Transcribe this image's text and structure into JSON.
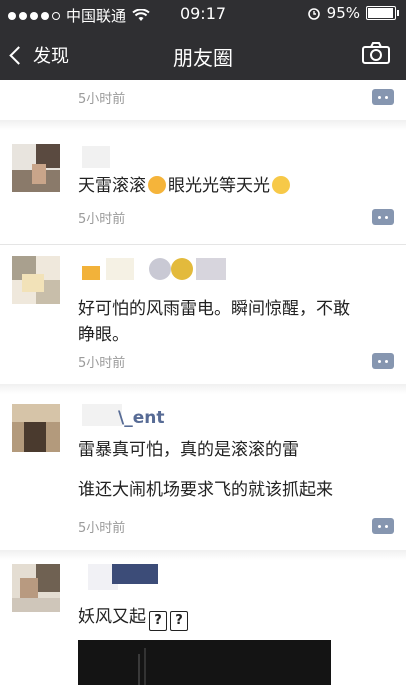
{
  "status_bar": {
    "carrier": "中国联通",
    "time": "09:17",
    "battery": "95%",
    "battery_level": 0.95
  },
  "nav": {
    "back_label": "发现",
    "title": "朋友圈"
  },
  "posts": [
    {
      "time": "5小时前"
    },
    {
      "text": "天雷滚滚😱眼光光等天光😁",
      "text_parts": [
        "天雷滚滚",
        "眼光光等天光"
      ],
      "time": "5小时前"
    },
    {
      "text_lines": [
        "好可怕的风雨雷电。瞬间惊醒，不敢",
        "睁眼。"
      ],
      "time": "5小时前"
    },
    {
      "name": "\\_ent",
      "text_lines": [
        "雷暴真可怕，真的是滚滚的雷",
        "谁还大闹机场要求飞的就该抓起来"
      ],
      "time": "5小时前"
    },
    {
      "text": "妖风又起",
      "marks": [
        "?",
        "?"
      ]
    }
  ],
  "icons": {
    "back": "chevron-left-icon",
    "camera": "camera-icon",
    "wifi": "wifi-icon",
    "alarm": "alarm-icon",
    "comment": "comment-icon"
  },
  "colors": {
    "nav_bg": "#2f2f32",
    "name_color": "#576b95",
    "time_color": "#9b9b9b",
    "comment_btn": "#8696b0"
  }
}
